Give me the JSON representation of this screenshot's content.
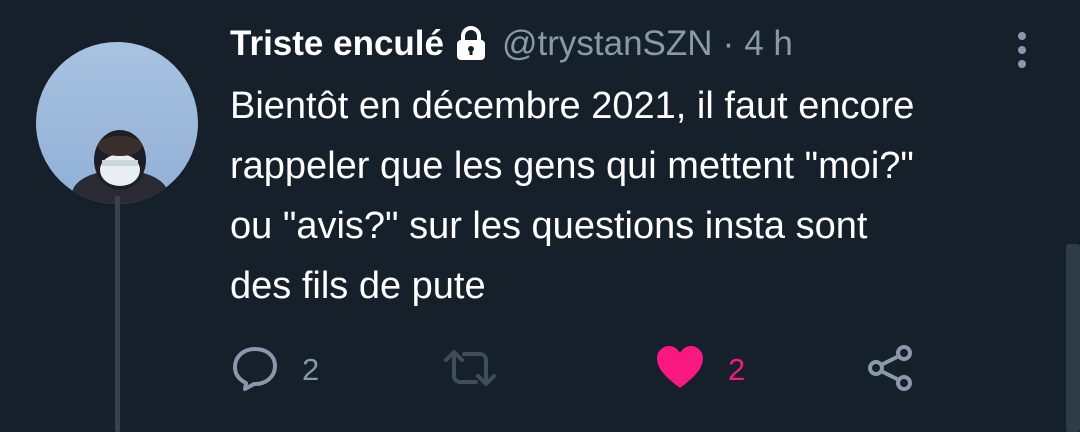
{
  "tweet": {
    "display_name": "Triste enculé",
    "handle": "@trystanSZN",
    "separator": "·",
    "time": "4 h",
    "text_lines": [
      "Bientôt en décembre 2021, il faut encore",
      "rappeler que les gens qui mettent \"moi?\"",
      "ou \"avis?\" sur les questions insta sont",
      "des fils de pute"
    ]
  },
  "actions": {
    "reply_count": "2",
    "like_count": "2"
  },
  "icons": {
    "lock": "lock-icon",
    "more": "more-vertical-icon",
    "reply": "reply-icon",
    "retweet": "retweet-icon",
    "like": "heart-icon",
    "share": "share-icon"
  },
  "colors": {
    "background": "#15202b",
    "secondary_text": "#8b98a5",
    "like": "#f91880"
  }
}
